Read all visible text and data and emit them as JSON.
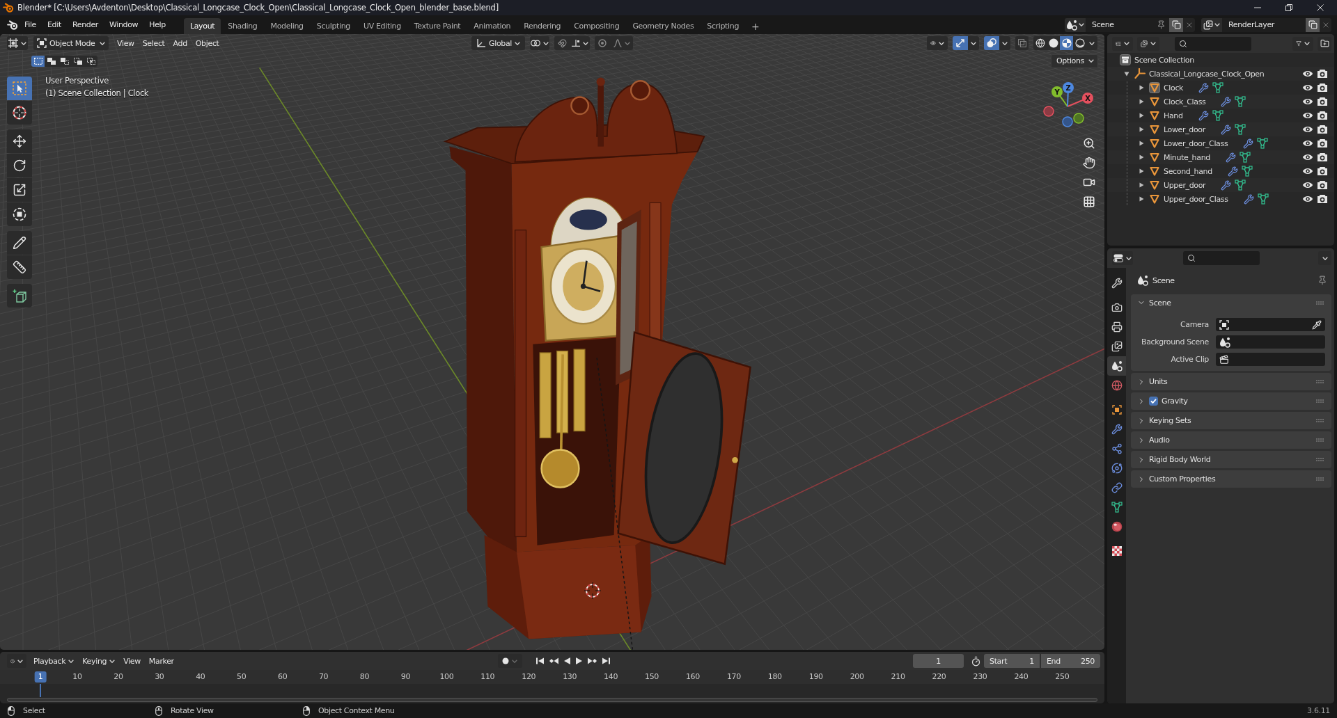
{
  "window": {
    "title": "Blender* [C:\\Users\\Avdenton\\Desktop\\Classical_Longcase_Clock_Open\\Classical_Longcase_Clock_Open_blender_base.blend]"
  },
  "topbar": {
    "menus": [
      "File",
      "Edit",
      "Render",
      "Window",
      "Help"
    ],
    "workspaces": [
      {
        "label": "Layout",
        "selected": true
      },
      {
        "label": "Shading",
        "selected": false
      },
      {
        "label": "Modeling",
        "selected": false
      },
      {
        "label": "Sculpting",
        "selected": false
      },
      {
        "label": "UV Editing",
        "selected": false
      },
      {
        "label": "Texture Paint",
        "selected": false
      },
      {
        "label": "Animation",
        "selected": false
      },
      {
        "label": "Rendering",
        "selected": false
      },
      {
        "label": "Compositing",
        "selected": false
      },
      {
        "label": "Geometry Nodes",
        "selected": false
      },
      {
        "label": "Scripting",
        "selected": false
      }
    ],
    "add_workspace": "+",
    "scene": "Scene",
    "view_layer": "RenderLayer"
  },
  "viewport": {
    "header": {
      "mode": "Object Mode",
      "menus": [
        "View",
        "Select",
        "Add",
        "Object"
      ],
      "orientation": "Global",
      "toggles": [
        {
          "kind": "gizmos",
          "on": true
        },
        {
          "kind": "overlays",
          "on": true
        },
        {
          "kind": "xray",
          "on": false
        }
      ],
      "shading": [
        {
          "kind": "wireframe",
          "selected": false
        },
        {
          "kind": "solid",
          "selected": false
        },
        {
          "kind": "material",
          "selected": true
        },
        {
          "kind": "rendered",
          "selected": false
        }
      ]
    },
    "select_modes": [
      {
        "kind": "set",
        "selected": true
      },
      {
        "kind": "extend",
        "selected": false
      },
      {
        "kind": "subtract",
        "selected": false
      },
      {
        "kind": "invert",
        "selected": false
      },
      {
        "kind": "intersect",
        "selected": false
      }
    ],
    "options": "Options",
    "overlay": [
      "User Perspective",
      "(1) Scene Collection | Clock"
    ],
    "tool_groups": [
      {
        "tools": [
          {
            "kind": "select",
            "selected": true
          },
          {
            "kind": "cursor",
            "selected": false
          }
        ]
      },
      {
        "tools": [
          {
            "kind": "move",
            "selected": false
          },
          {
            "kind": "rotate",
            "selected": false
          },
          {
            "kind": "scale",
            "selected": false
          },
          {
            "kind": "transform",
            "selected": false
          }
        ]
      },
      {
        "tools": [
          {
            "kind": "annotate",
            "selected": false
          },
          {
            "kind": "measure",
            "selected": false
          }
        ]
      },
      {
        "tools": [
          {
            "kind": "add_cube",
            "selected": false
          }
        ]
      }
    ],
    "gizmo": [
      {
        "kind": "x",
        "label": "X"
      },
      {
        "kind": "y",
        "label": "Y"
      },
      {
        "kind": "z",
        "label": "Z"
      }
    ]
  },
  "outliner": {
    "items": [
      {
        "label": "Scene Collection",
        "kind": "scene_collection",
        "children": [
          {
            "label": "Classical_Longcase_Clock_Open",
            "kind": "collection",
            "expanded": true,
            "children": [
              {
                "label": "Clock",
                "kind": "mesh",
                "expanded": false,
                "active": true
              },
              {
                "label": "Clock_Class",
                "kind": "mesh",
                "expanded": false,
                "active": false
              },
              {
                "label": "Hand",
                "kind": "mesh",
                "expanded": false,
                "active": false
              },
              {
                "label": "Lower_door",
                "kind": "mesh",
                "expanded": false,
                "active": false
              },
              {
                "label": "Lower_door_Class",
                "kind": "mesh",
                "expanded": false,
                "active": false
              },
              {
                "label": "Minute_hand",
                "kind": "mesh",
                "expanded": false,
                "active": false
              },
              {
                "label": "Second_hand",
                "kind": "mesh",
                "expanded": false,
                "active": false
              },
              {
                "label": "Upper_door",
                "kind": "mesh",
                "expanded": false,
                "active": false
              },
              {
                "label": "Upper_door_Class",
                "kind": "mesh",
                "expanded": false,
                "active": false
              }
            ]
          }
        ]
      }
    ]
  },
  "properties": {
    "tab_groups": [
      {
        "tabs": [
          {
            "kind": "tool",
            "selected": false
          }
        ]
      },
      {
        "tabs": [
          {
            "kind": "render",
            "selected": false
          },
          {
            "kind": "output",
            "selected": false
          },
          {
            "kind": "view_layer",
            "selected": false
          },
          {
            "kind": "scene",
            "selected": true
          },
          {
            "kind": "world",
            "selected": false
          }
        ]
      },
      {
        "tabs": [
          {
            "kind": "object",
            "selected": false
          },
          {
            "kind": "modifiers",
            "selected": false
          },
          {
            "kind": "particles",
            "selected": false
          },
          {
            "kind": "physics",
            "selected": false
          },
          {
            "kind": "constraints",
            "selected": false
          },
          {
            "kind": "data",
            "selected": false
          },
          {
            "kind": "material",
            "selected": false
          }
        ]
      },
      {
        "tabs": [
          {
            "kind": "texture",
            "selected": false
          }
        ]
      }
    ],
    "context": "Scene",
    "panels": [
      {
        "title": "Scene",
        "expanded": true,
        "fields": [
          {
            "label": "Camera",
            "kind": "camera"
          },
          {
            "label": "Background Scene",
            "kind": "scene"
          },
          {
            "label": "Active Clip",
            "kind": "clip"
          }
        ]
      },
      {
        "title": "Units",
        "expanded": false
      },
      {
        "title": "Gravity",
        "expanded": false,
        "checkbox": {
          "checked": true
        }
      },
      {
        "title": "Keying Sets",
        "expanded": false
      },
      {
        "title": "Audio",
        "expanded": false
      },
      {
        "title": "Rigid Body World",
        "expanded": false
      },
      {
        "title": "Custom Properties",
        "expanded": false
      }
    ]
  },
  "timeline": {
    "menus": [
      {
        "label": "Playback",
        "kind": "dropdown"
      },
      {
        "label": "Keying",
        "kind": "dropdown"
      },
      {
        "label": "View",
        "kind": "menu"
      },
      {
        "label": "Marker",
        "kind": "menu"
      }
    ],
    "current_frame": "1",
    "start_label": "Start",
    "start": "1",
    "end_label": "End",
    "end": "250",
    "playhead": "1",
    "ruler": [
      "10",
      "20",
      "30",
      "40",
      "50",
      "60",
      "70",
      "80",
      "90",
      "100",
      "110",
      "120",
      "130",
      "140",
      "150",
      "160",
      "170",
      "180",
      "190",
      "200",
      "210",
      "220",
      "230",
      "240",
      "250"
    ]
  },
  "status_bar": {
    "hints": [
      {
        "kind": "left",
        "label": "Select"
      },
      {
        "kind": "middle",
        "label": "Rotate View"
      },
      {
        "kind": "right",
        "label": "Object Context Menu"
      }
    ],
    "version": "3.6.11"
  }
}
